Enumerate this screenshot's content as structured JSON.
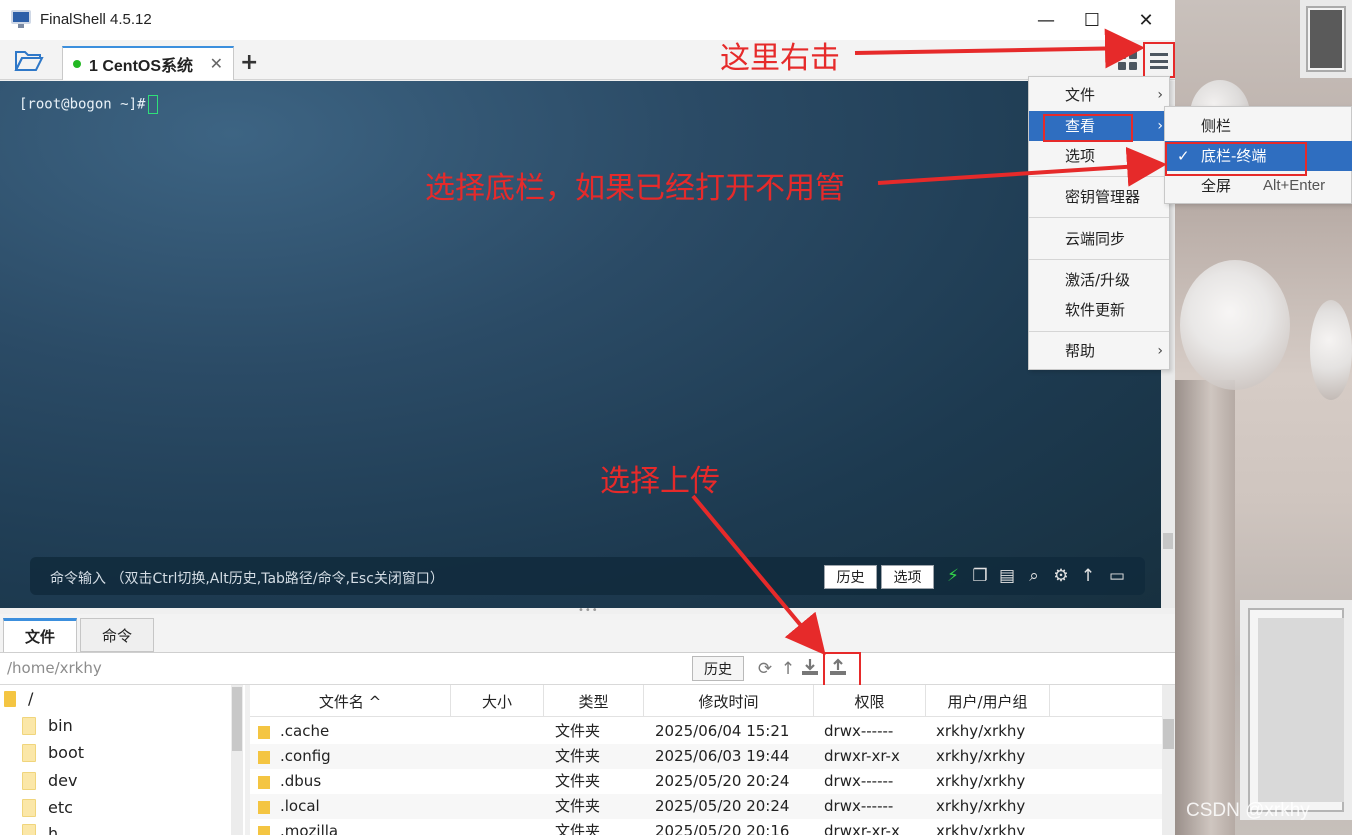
{
  "window": {
    "title": "FinalShell 4.5.12",
    "min_glyph": "—",
    "max_glyph": "☐",
    "close_glyph": "✕"
  },
  "tabs": {
    "session_label": "1 CentOS系统",
    "close_glyph": "✕",
    "add_glyph": "+"
  },
  "terminal": {
    "prompt": "[root@bogon ~]#"
  },
  "command_bar": {
    "placeholder": "命令输入 （双击Ctrl切换,Alt历史,Tab路径/命令,Esc关闭窗口）",
    "history_label": "历史",
    "options_label": "选项",
    "icons": [
      "lightning-icon",
      "copy-icon",
      "paste-icon",
      "search-icon",
      "gear-icon",
      "up-arrow-icon",
      "window-icon"
    ]
  },
  "bottom_tabs": {
    "files_label": "文件",
    "command_label": "命令"
  },
  "path_bar": {
    "path": "/home/xrkhy",
    "history_label": "历史"
  },
  "tree": {
    "root": "/",
    "items": [
      "bin",
      "boot",
      "dev",
      "etc",
      "h"
    ]
  },
  "file_list": {
    "columns": [
      "文件名 ^",
      "大小",
      "类型",
      "修改时间",
      "权限",
      "用户/用户组"
    ],
    "rows": [
      {
        "name": ".cache",
        "size": "",
        "type": "文件夹",
        "mtime": "2025/06/04 15:21",
        "perm": "drwx------",
        "owner": "xrkhy/xrkhy"
      },
      {
        "name": ".config",
        "size": "",
        "type": "文件夹",
        "mtime": "2025/06/03 19:44",
        "perm": "drwxr-xr-x",
        "owner": "xrkhy/xrkhy"
      },
      {
        "name": ".dbus",
        "size": "",
        "type": "文件夹",
        "mtime": "2025/05/20 20:24",
        "perm": "drwx------",
        "owner": "xrkhy/xrkhy"
      },
      {
        "name": ".local",
        "size": "",
        "type": "文件夹",
        "mtime": "2025/05/20 20:24",
        "perm": "drwx------",
        "owner": "xrkhy/xrkhy"
      },
      {
        "name": ".mozilla",
        "size": "",
        "type": "文件夹",
        "mtime": "2025/05/20 20:16",
        "perm": "drwxr-xr-x",
        "owner": "xrkhy/xrkhy"
      }
    ]
  },
  "main_menu": {
    "items": [
      {
        "label": "文件",
        "submenu": true
      },
      {
        "label": "查看",
        "submenu": true
      },
      {
        "label": "选项",
        "submenu": false
      },
      {
        "label": "密钥管理器",
        "submenu": false
      },
      {
        "label": "云端同步",
        "submenu": false
      },
      {
        "label": "激活/升级",
        "submenu": false
      },
      {
        "label": "软件更新",
        "submenu": false
      },
      {
        "label": "帮助",
        "submenu": true
      }
    ],
    "arrow_glyph": "›"
  },
  "view_submenu": {
    "items": [
      {
        "label": "侧栏",
        "checked": false,
        "shortcut": ""
      },
      {
        "label": "底栏-终端",
        "checked": true,
        "shortcut": ""
      },
      {
        "label": "全屏",
        "checked": false,
        "shortcut": "Alt+Enter"
      }
    ],
    "check_glyph": "✓"
  },
  "annotations": {
    "right_click": "这里右击",
    "select_bottom_bar": "选择底栏，如果已经打开不用管",
    "select_upload": "选择上传"
  },
  "watermark": "CSDN @xrkhy",
  "colors": {
    "annotation_red": "#e62a2a",
    "menu_highlight": "#2f6ec0",
    "tab_accent": "#3c8fdd",
    "terminal_bg": "#2b4b66",
    "session_dot": "#22b822"
  }
}
